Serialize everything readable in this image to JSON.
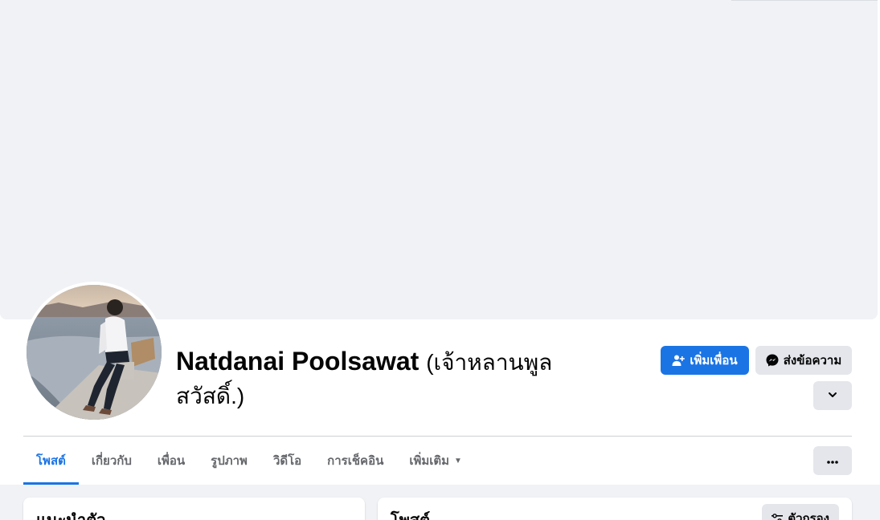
{
  "profile": {
    "name": "Natdanai Poolsawat",
    "alternate_name": "(เจ้าหลานพูลสวัสดิ์.)"
  },
  "actions": {
    "add_friend_label": "เพิ่มเพื่อน",
    "message_label": "ส่งข้อความ",
    "add_friend_icon": "add-person-icon",
    "message_icon": "messenger-icon",
    "expand_icon": "chevron-down-icon"
  },
  "tabs": [
    {
      "label": "โพสต์",
      "active": true
    },
    {
      "label": "เกี่ยวกับ",
      "active": false
    },
    {
      "label": "เพื่อน",
      "active": false
    },
    {
      "label": "รูปภาพ",
      "active": false
    },
    {
      "label": "วิดีโอ",
      "active": false
    },
    {
      "label": "การเช็คอิน",
      "active": false
    },
    {
      "label": "เพิ่มเติม",
      "active": false
    }
  ],
  "more_icon": "more-horizontal-icon",
  "intro_card": {
    "title": "แนะนำตัว"
  },
  "posts_card": {
    "title": "โพสต์",
    "filter_label": "ตัวกรอง",
    "filter_icon": "filter-icon"
  },
  "colors": {
    "accent": "#1b74e4",
    "cover": "#f0f2f5",
    "secondary_button": "#e4e6eb",
    "text_primary": "#050505",
    "text_secondary": "#65676b"
  }
}
